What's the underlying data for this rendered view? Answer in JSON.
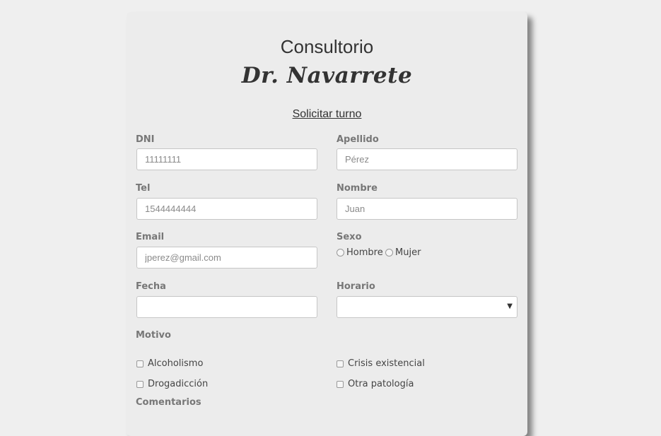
{
  "header": {
    "title": "Consultorio",
    "subtitle": "Dr. Navarrete"
  },
  "form": {
    "heading": "Solicitar turno",
    "dni": {
      "label": "DNI",
      "placeholder": "11111111"
    },
    "apellido": {
      "label": "Apellido",
      "placeholder": "Pérez"
    },
    "tel": {
      "label": "Tel",
      "placeholder": "1544444444"
    },
    "nombre": {
      "label": "Nombre",
      "placeholder": "Juan"
    },
    "email": {
      "label": "Email",
      "placeholder": "jperez@gmail.com"
    },
    "sexo": {
      "label": "Sexo",
      "options": [
        "Hombre",
        "Mujer"
      ]
    },
    "fecha": {
      "label": "Fecha",
      "value": ""
    },
    "horario": {
      "label": "Horario",
      "selected": ""
    },
    "motivo": {
      "label": "Motivo",
      "options": [
        "Alcoholismo",
        "Crisis existencial",
        "Drogadicción",
        "Otra patología"
      ]
    },
    "comentarios": {
      "label": "Comentarios"
    }
  }
}
